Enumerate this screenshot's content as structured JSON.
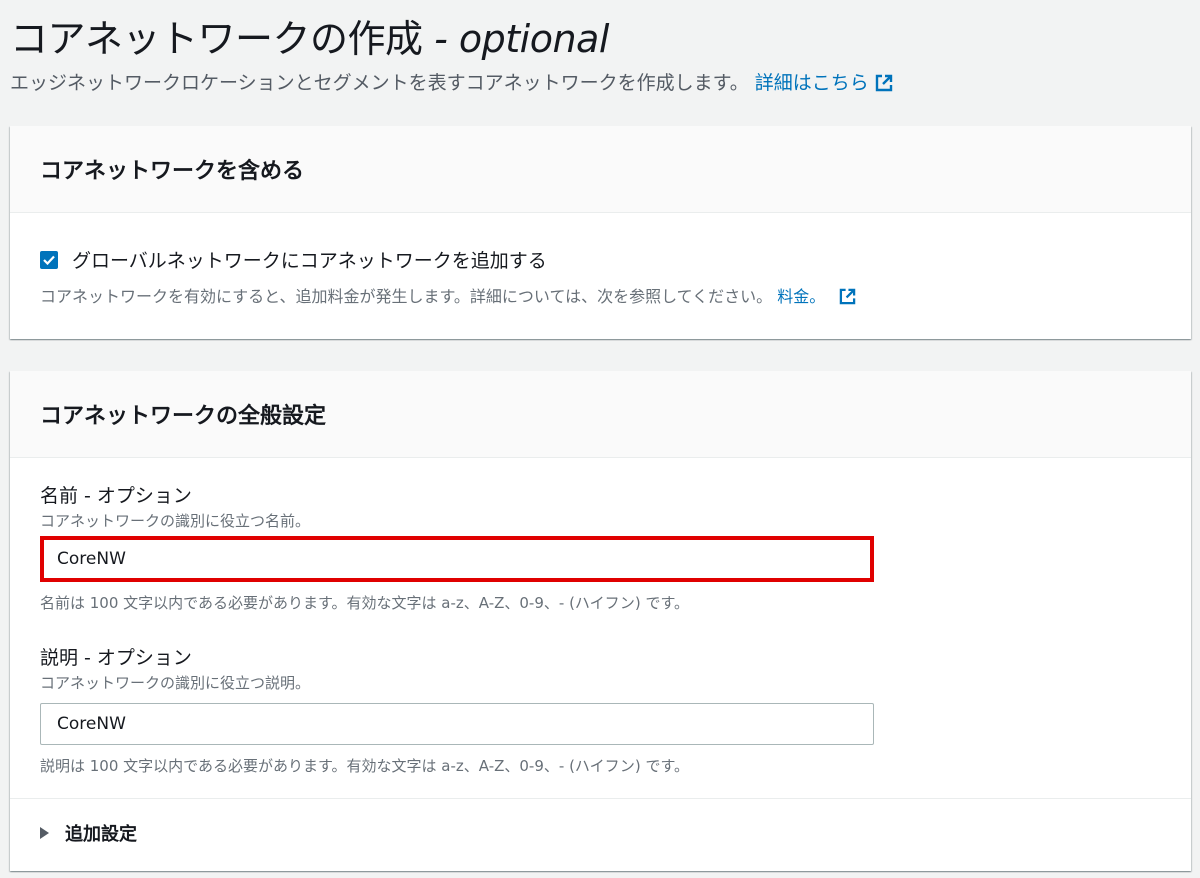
{
  "page": {
    "title": "コアネットワークの作成",
    "title_suffix": " - optional",
    "description": "エッジネットワークロケーションとセグメントを表すコアネットワークを作成します。",
    "learn_more": "詳細はこちら"
  },
  "include_panel": {
    "header": "コアネットワークを含める",
    "checkbox_label": "グローバルネットワークにコアネットワークを追加する",
    "checkbox_checked": true,
    "checkbox_description": "コアネットワークを有効にすると、追加料金が発生します。詳細については、次を参照してください。",
    "pricing_link": "料金。"
  },
  "general_panel": {
    "header": "コアネットワークの全般設定",
    "name": {
      "label": "名前 - オプション",
      "description": "コアネットワークの識別に役立つ名前。",
      "value": "CoreNW",
      "constraint": "名前は 100 文字以内である必要があります。有効な文字は a-z、A-Z、0-9、- (ハイフン) です。"
    },
    "description": {
      "label": "説明 - オプション",
      "description": "コアネットワークの識別に役立つ説明。",
      "value": "CoreNW",
      "constraint": "説明は 100 文字以内である必要があります。有効な文字は a-z、A-Z、0-9、- (ハイフン) です。"
    },
    "additional_settings": "追加設定"
  },
  "colors": {
    "link": "#0073bb",
    "highlight": "#e00000",
    "checkbox": "#0073bb"
  }
}
